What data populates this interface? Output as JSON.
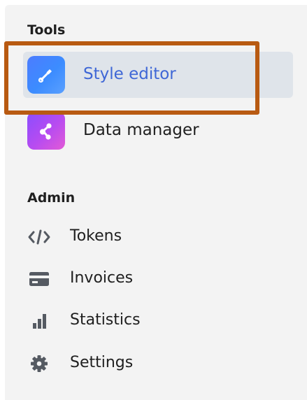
{
  "colors": {
    "panel_background": "#f3f3f3",
    "selected_background": "#dfe4ea",
    "selected_text": "#3f67d6",
    "highlight_border": "#b85a12",
    "icon_gray": "#555a62"
  },
  "sections": {
    "tools": {
      "title": "Tools",
      "items": [
        {
          "label": "Style editor",
          "icon": "brush-icon",
          "selected": true
        },
        {
          "label": "Data manager",
          "icon": "share-nodes-icon",
          "selected": false
        }
      ]
    },
    "admin": {
      "title": "Admin",
      "items": [
        {
          "label": "Tokens",
          "icon": "code-icon"
        },
        {
          "label": "Invoices",
          "icon": "credit-card-icon"
        },
        {
          "label": "Statistics",
          "icon": "bar-chart-icon"
        },
        {
          "label": "Settings",
          "icon": "gear-icon"
        }
      ]
    }
  }
}
